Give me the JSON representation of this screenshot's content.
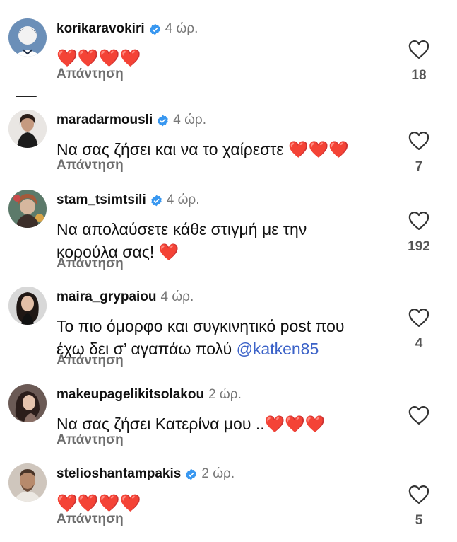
{
  "comments": [
    {
      "username": "korikaravokiri",
      "verified": true,
      "time": "4 ώρ.",
      "text": "❤️❤️❤️❤️",
      "reply": "Απάντηση",
      "likes": "18"
    },
    {
      "username": "maradarmousli",
      "verified": true,
      "time": "4 ώρ.",
      "text": "Να σας ζήσει και να το χαίρεστε ❤️❤️❤️",
      "reply": "Απάντηση",
      "likes": "7"
    },
    {
      "username": "stam_tsimtsili",
      "verified": true,
      "time": "4 ώρ.",
      "text": "Να απολαύσετε κάθε στιγμή με την κορούλα σας! ❤️",
      "reply": "Απάντηση",
      "likes": "192"
    },
    {
      "username": "maira_grypaiou",
      "verified": false,
      "time": "4 ώρ.",
      "text": "Το πιο όμορφο και συγκινητικό post που έχω δει σ’ αγαπάω πολύ ",
      "mention": "@katken85",
      "reply": "Απάντηση",
      "likes": "4"
    },
    {
      "username": "makeupagelikitsolakou",
      "verified": false,
      "time": "2 ώρ.",
      "text": "Να σας ζήσει Κατερίνα μου ..❤️❤️❤️",
      "reply": "Απάντηση",
      "likes": ""
    },
    {
      "username": "stelioshantampakis",
      "verified": true,
      "time": "2 ώρ.",
      "text": "❤️❤️❤️❤️",
      "reply": "Απάντηση",
      "likes": "5"
    }
  ],
  "icons": {
    "verified": "verified-badge-icon",
    "like": "heart-outline-icon"
  },
  "colors": {
    "verified": "#3897f0",
    "mention": "#3b62c8",
    "secondary_text": "#6d6d6d",
    "heart": "#e0102a"
  }
}
